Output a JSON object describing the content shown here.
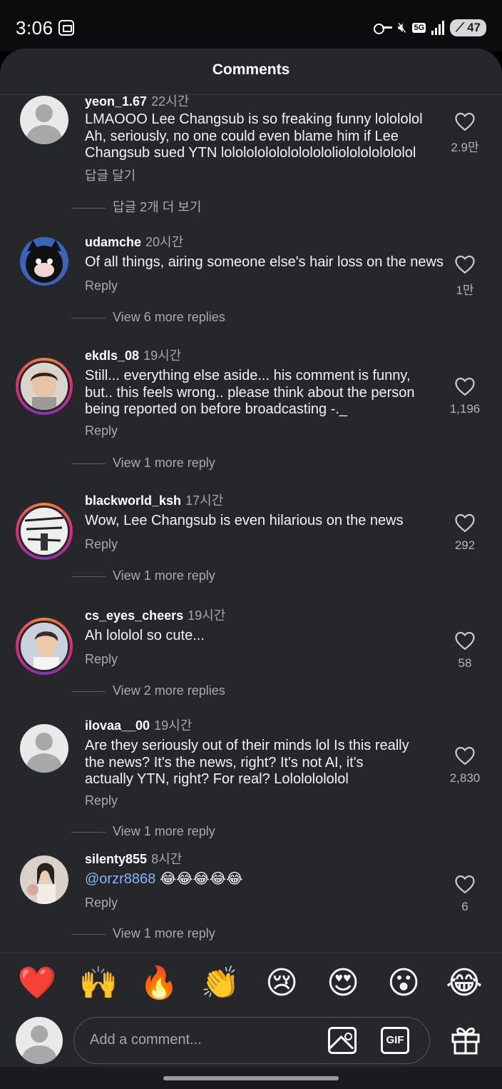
{
  "status_bar": {
    "time": "3:06",
    "battery": "47",
    "network": "5G"
  },
  "sheet": {
    "title": "Comments"
  },
  "comments": [
    {
      "username": "yeon_1.67",
      "time": "22시간",
      "lines": [
        "LMAOOO Lee Changsub is so freaking funny lolololol",
        "Ah, seriously, no one could even blame him if Lee",
        "Changsub sued YTN lololololololololololiololololololol"
      ],
      "reply_label": "답글 달기",
      "likes": "2.9만",
      "more_replies": "답글 2개 더 보기",
      "avatar": "default"
    },
    {
      "username": "udamche",
      "time": "20시간",
      "lines": [
        "Of all things, airing someone else's hair loss on the news"
      ],
      "reply_label": "Reply",
      "likes": "1만",
      "more_replies": "View 6 more replies",
      "avatar": "cat"
    },
    {
      "username": "ekdls_08",
      "time": "19시간",
      "lines": [
        "Still... everything else aside... his comment is funny,",
        "but.. this feels wrong.. please think about the person",
        "being reported on before broadcasting -._"
      ],
      "reply_label": "Reply",
      "likes": "1,196",
      "more_replies": "View 1 more reply",
      "avatar": "photo"
    },
    {
      "username": "blackworld_ksh",
      "time": "17시간",
      "lines": [
        "Wow, Lee Changsub is even hilarious on the news"
      ],
      "reply_label": "Reply",
      "likes": "292",
      "more_replies": "View 1 more reply",
      "avatar": "graffiti"
    },
    {
      "username": "cs_eyes_cheers",
      "time": "19시간",
      "lines": [
        "Ah lololol so cute..."
      ],
      "reply_label": "Reply",
      "likes": "58",
      "more_replies": "View 2 more replies",
      "avatar": "photo2"
    },
    {
      "username": "ilovaa__00",
      "time": "19시간",
      "lines": [
        "Are they seriously out of their minds lol Is this really",
        "the news? It's the news, right? It's not AI, it's",
        "actually YTN, right? For real? Lolololololol"
      ],
      "reply_label": "Reply",
      "likes": "2,830",
      "more_replies": "View 1 more reply",
      "avatar": "default"
    },
    {
      "username": "silenty855",
      "time": "8시간",
      "mention": "@orzr8868",
      "emojis": "😂😂😂😂😂",
      "reply_label": "Reply",
      "likes": "6",
      "more_replies": "View 1 more reply",
      "avatar": "girl"
    }
  ],
  "reactions": [
    "❤️",
    "🙌",
    "🔥",
    "👏",
    "😢",
    "😍",
    "😮",
    "😂"
  ],
  "composer": {
    "placeholder": "Add a comment..."
  },
  "icons": {
    "image": "image-icon",
    "gif": "GIF",
    "gift": "gift-icon",
    "heart": "heart-outline-icon"
  }
}
